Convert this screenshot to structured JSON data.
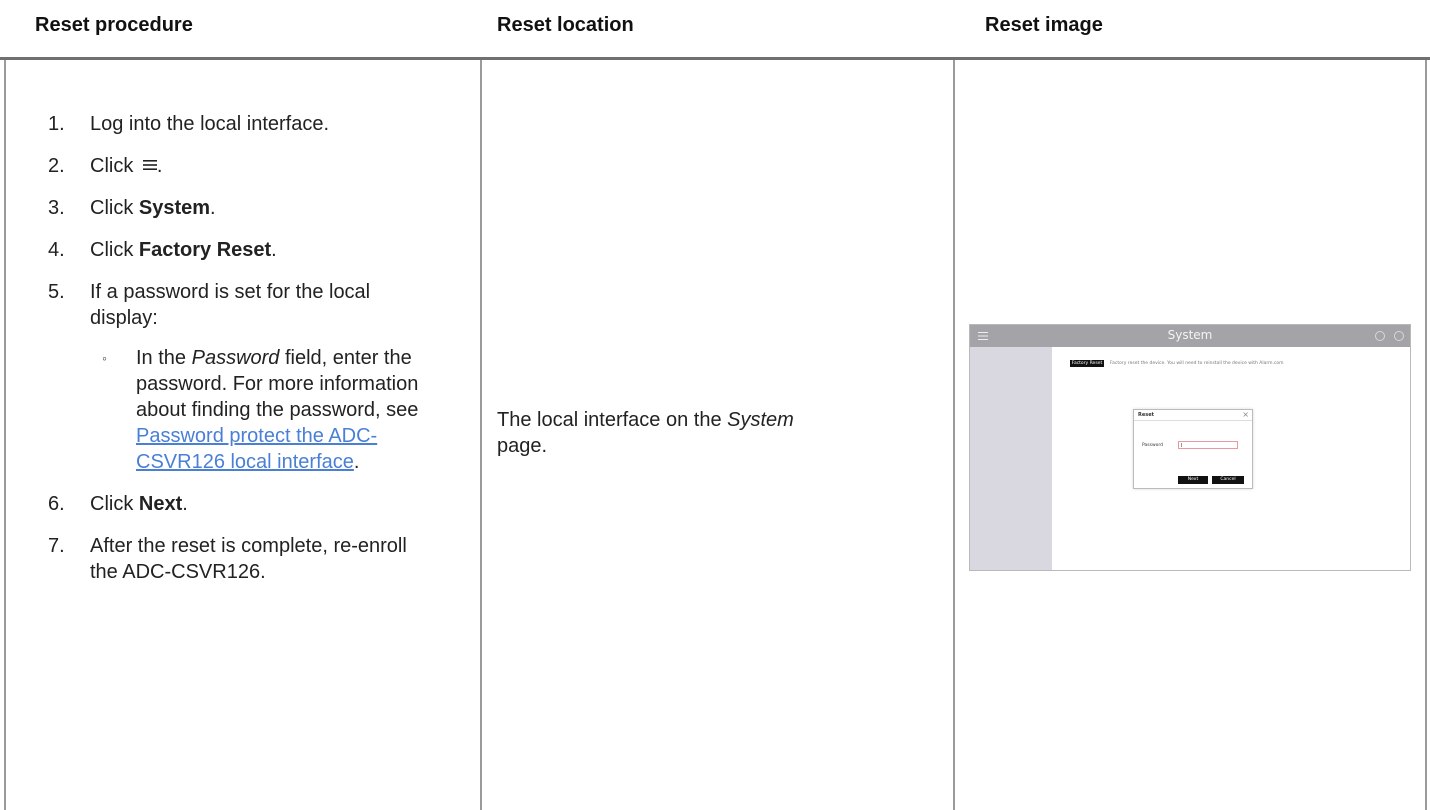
{
  "headers": {
    "procedure": "Reset procedure",
    "location": "Reset location",
    "image": "Reset image"
  },
  "steps": [
    {
      "num": "1",
      "text": "Log into the local interface."
    },
    {
      "num": "2",
      "prefix": "Click ",
      "icon": "menu-icon",
      "suffix": "."
    },
    {
      "num": "3",
      "prefix": "Click ",
      "bold": "System",
      "suffix": "."
    },
    {
      "num": "4",
      "prefix": "Click ",
      "bold": "Factory Reset",
      "suffix": "."
    },
    {
      "num": "5",
      "text": "If a password is set for the local display:",
      "sub": {
        "pre": "In the ",
        "italic": "Password",
        "mid": " field, enter the password. For more information about finding the password, see ",
        "link": "Password protect the ADC-CSVR126 local interface",
        "post": "."
      }
    },
    {
      "num": "6",
      "prefix": "Click ",
      "bold": "Next",
      "suffix": "."
    },
    {
      "num": "7",
      "text": "After the reset is complete, re-enroll the ADC-CSVR126."
    }
  ],
  "location": {
    "pre": "The local interface on the ",
    "italic": "System",
    "post": " page."
  },
  "thumbnail": {
    "title": "System",
    "factory_reset_button": "Factory Reset",
    "factory_reset_text": "Factory reset the device. You will need to reinstall the device with Alarm.com",
    "dialog_title": "Reset",
    "password_label": "Password",
    "next_button": "Next",
    "cancel_button": "Cancel"
  }
}
